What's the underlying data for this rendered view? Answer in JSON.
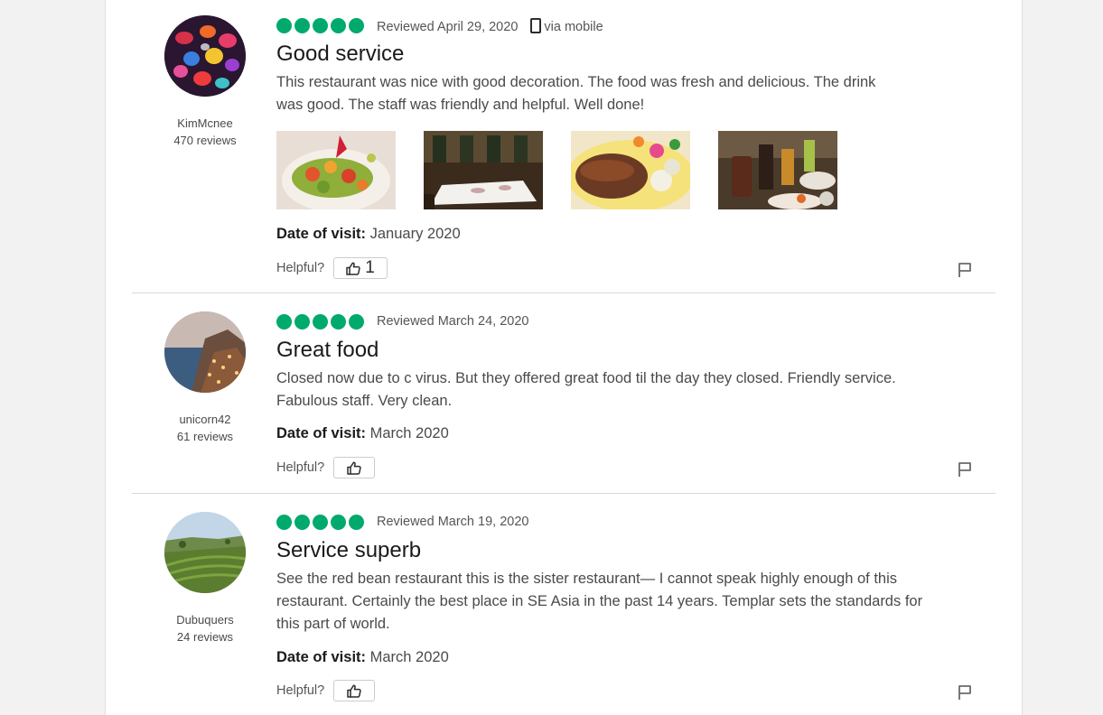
{
  "ui": {
    "helpful_label": "Helpful?",
    "date_of_visit_label": "Date of visit:",
    "mobile_label": "via mobile"
  },
  "reviews": [
    {
      "username": "KimMcnee",
      "review_count": "470 reviews",
      "rating": 5,
      "reviewed_date": "Reviewed April 29, 2020",
      "title": "Good service",
      "text": "This restaurant was nice with good decoration. The food was fresh and delicious. The drink was good. The staff was friendly and helpful. Well done!",
      "date_of_visit": "January 2020",
      "helpful_count": "1",
      "photos": [
        "salad-photo",
        "dining-room-photo",
        "roast-duck-photo",
        "drinks-table-photo"
      ]
    },
    {
      "username": "unicorn42",
      "review_count": "61 reviews",
      "rating": 5,
      "reviewed_date": "Reviewed March 24, 2020",
      "title": "Great food",
      "text": "Closed now due to c virus. But they offered great food til the day they closed. Friendly service. Fabulous staff. Very clean.",
      "date_of_visit": "March 2020"
    },
    {
      "username": "Dubuquers",
      "review_count": "24 reviews",
      "rating": 5,
      "reviewed_date": "Reviewed March 19, 2020",
      "title": "Service superb",
      "text": "See the red bean restaurant this is the sister restaurant— I cannot speak highly enough of this restaurant. Certainly the best place in SE Asia in the past 14 years. Templar sets the standards for this part of world.",
      "date_of_visit": "March 2020"
    }
  ],
  "colors": {
    "bubble": "#00aa6c",
    "page_background": "#f2f2f2",
    "card_background": "#ffffff"
  }
}
